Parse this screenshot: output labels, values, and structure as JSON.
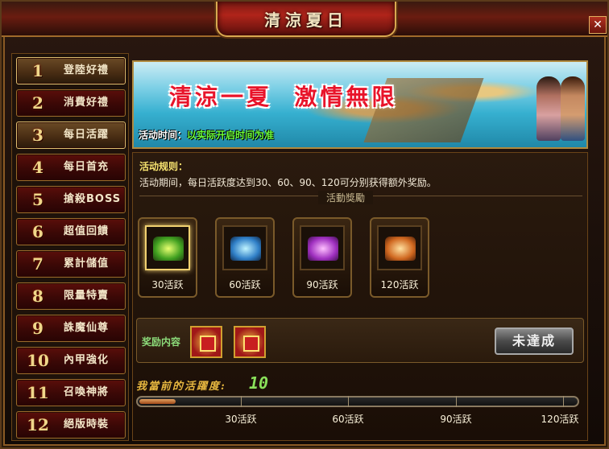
{
  "window": {
    "title": "清涼夏日",
    "close_label": "✕"
  },
  "sidebar": {
    "items": [
      {
        "num": "1",
        "label": "登陸好禮",
        "active": true
      },
      {
        "num": "2",
        "label": "消費好禮",
        "active": false
      },
      {
        "num": "3",
        "label": "每日活躍",
        "active": true
      },
      {
        "num": "4",
        "label": "每日首充",
        "active": false
      },
      {
        "num": "5",
        "label": "搶殺BOSS",
        "active": false
      },
      {
        "num": "6",
        "label": "超值回饋",
        "active": false
      },
      {
        "num": "7",
        "label": "累計儲值",
        "active": false
      },
      {
        "num": "8",
        "label": "限量特賣",
        "active": false
      },
      {
        "num": "9",
        "label": "誅魔仙尊",
        "active": false
      },
      {
        "num": "10",
        "label": "內甲強化",
        "active": false
      },
      {
        "num": "11",
        "label": "召喚神將",
        "active": false
      },
      {
        "num": "12",
        "label": "絕版時裝",
        "active": false
      }
    ]
  },
  "banner": {
    "headline": "清涼一夏  激情無限",
    "time_label": "活动时间：",
    "time_value": "以实际开启时间为准"
  },
  "rules": {
    "title": "活动规则：",
    "text": "活动期间，每日活跃度达到30、60、90、120可分别获得额外奖励。",
    "section_label": "活動獎勵"
  },
  "chests": [
    {
      "label": "30活跃",
      "color": "green",
      "current": true
    },
    {
      "label": "60活跃",
      "color": "blue",
      "current": false
    },
    {
      "label": "90活跃",
      "color": "purple",
      "current": false
    },
    {
      "label": "120活跃",
      "color": "orange",
      "current": false
    }
  ],
  "reward": {
    "label": "奖励内容",
    "status_button": "未達成"
  },
  "activity": {
    "label": "我當前的活躍度:",
    "value": "10",
    "progress": 0.083,
    "ticks": [
      "30活跃",
      "60活跃",
      "90活跃",
      "120活跃"
    ]
  },
  "colors": {
    "accent_gold": "#e0c070",
    "progress_fill": "#c06a30",
    "value_green": "#8ae05a"
  }
}
